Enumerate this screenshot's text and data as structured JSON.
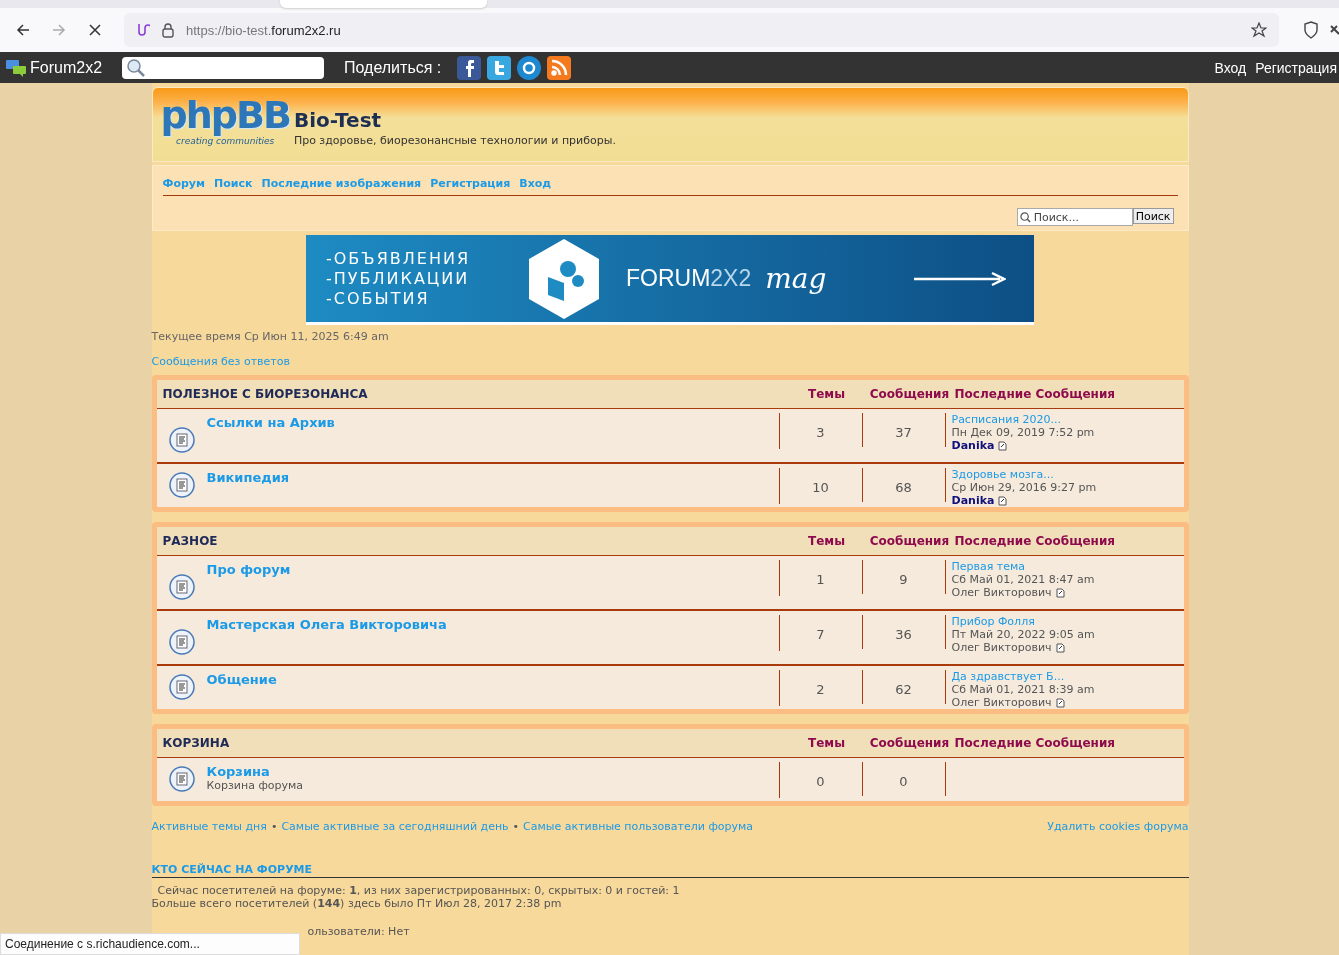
{
  "browser": {
    "url_prefix": "https://bio-test.",
    "url_domain": "forum2x2.ru"
  },
  "toolbar": {
    "brand": "Forum2x2",
    "share_label": "Поделиться :",
    "links": [
      "Вход",
      "Регистрация"
    ]
  },
  "header": {
    "logo_text": "phpBB",
    "logo_subtext": "creating communities",
    "title": "Bio-Test",
    "description": "Про здоровье, биорезонансные технологии и приборы."
  },
  "nav": [
    "Форум",
    "Поиск",
    "Последние изображения",
    "Регистрация",
    "Вход"
  ],
  "search": {
    "placeholder": "Поиск...",
    "button": "Поиск"
  },
  "banner": {
    "lines": [
      "-ОБЪЯВЛЕНИЯ",
      "-ПУБЛИКАЦИИ",
      "-СОБЫТИЯ"
    ],
    "brand": "FORUM",
    "brand_suffix": "2X2",
    "script": "mag"
  },
  "current_time": "Текущее время Ср Июн 11, 2025 6:49 am",
  "unanswered_link": "Сообщения без ответов",
  "categories": [
    {
      "title": "ПОЛЕЗНОЕ С БИОРЕЗОНАНСА",
      "columns": [
        "Темы",
        "Сообщения",
        "Последние Сообщения"
      ],
      "forums": [
        {
          "name": "Ссылки на Архив",
          "topics": "3",
          "posts": "37",
          "last_post": {
            "title": "Расписания 2020...",
            "date": "Пн Дек 09, 2019 7:52 pm",
            "author": "Danika",
            "highlighted": true
          }
        },
        {
          "name": "Википедия",
          "topics": "10",
          "posts": "68",
          "last_post": {
            "title": "Здоровье мозга...",
            "date": "Ср Июн 29, 2016 9:27 pm",
            "author": "Danika",
            "highlighted": true
          }
        }
      ]
    },
    {
      "title": "РАЗНОЕ",
      "columns": [
        "Темы",
        "Сообщения",
        "Последние Сообщения"
      ],
      "forums": [
        {
          "name": "Про форум",
          "topics": "1",
          "posts": "9",
          "last_post": {
            "title": "Первая тема",
            "date": "Сб Май 01, 2021 8:47 am",
            "author": "Олег Викторович",
            "highlighted": false
          }
        },
        {
          "name": "Мастерская Олега Викторовича",
          "topics": "7",
          "posts": "36",
          "last_post": {
            "title": "Прибор Фолля",
            "date": "Пт Май 20, 2022 9:05 am",
            "author": "Олег Викторович",
            "highlighted": false
          }
        },
        {
          "name": "Общение",
          "topics": "2",
          "posts": "62",
          "last_post": {
            "title": "Да здравствует Б...",
            "date": "Сб Май 01, 2021 8:39 am",
            "author": "Олег Викторович",
            "highlighted": false
          }
        }
      ]
    },
    {
      "title": "КОРЗИНА",
      "columns": [
        "Темы",
        "Сообщения",
        "Последние Сообщения"
      ],
      "forums": [
        {
          "name": "Корзина",
          "description": "Корзина форума",
          "topics": "0",
          "posts": "0"
        }
      ]
    }
  ],
  "footer_separator": "•",
  "footer_links": [
    "Активные темы дня",
    "Самые активные за сегодняшний день",
    "Самые активные пользователи форума"
  ],
  "delete_cookies": "Удалить cookies форума",
  "who_online": {
    "title": "КТО СЕЙЧАС НА ФОРУМЕ",
    "lines": [
      "Сейчас посетителей на форуме: **1**, из них зарегистрированных: 0, скрытых: 0 и гостей: 1",
      "Больше всего посетителей (**144**) здесь было Пт Июл 28, 2017 2:38 pm"
    ],
    "partial_line": "ользователи: Нет"
  },
  "status_bar": "Соединение с s.richaudience.com..."
}
